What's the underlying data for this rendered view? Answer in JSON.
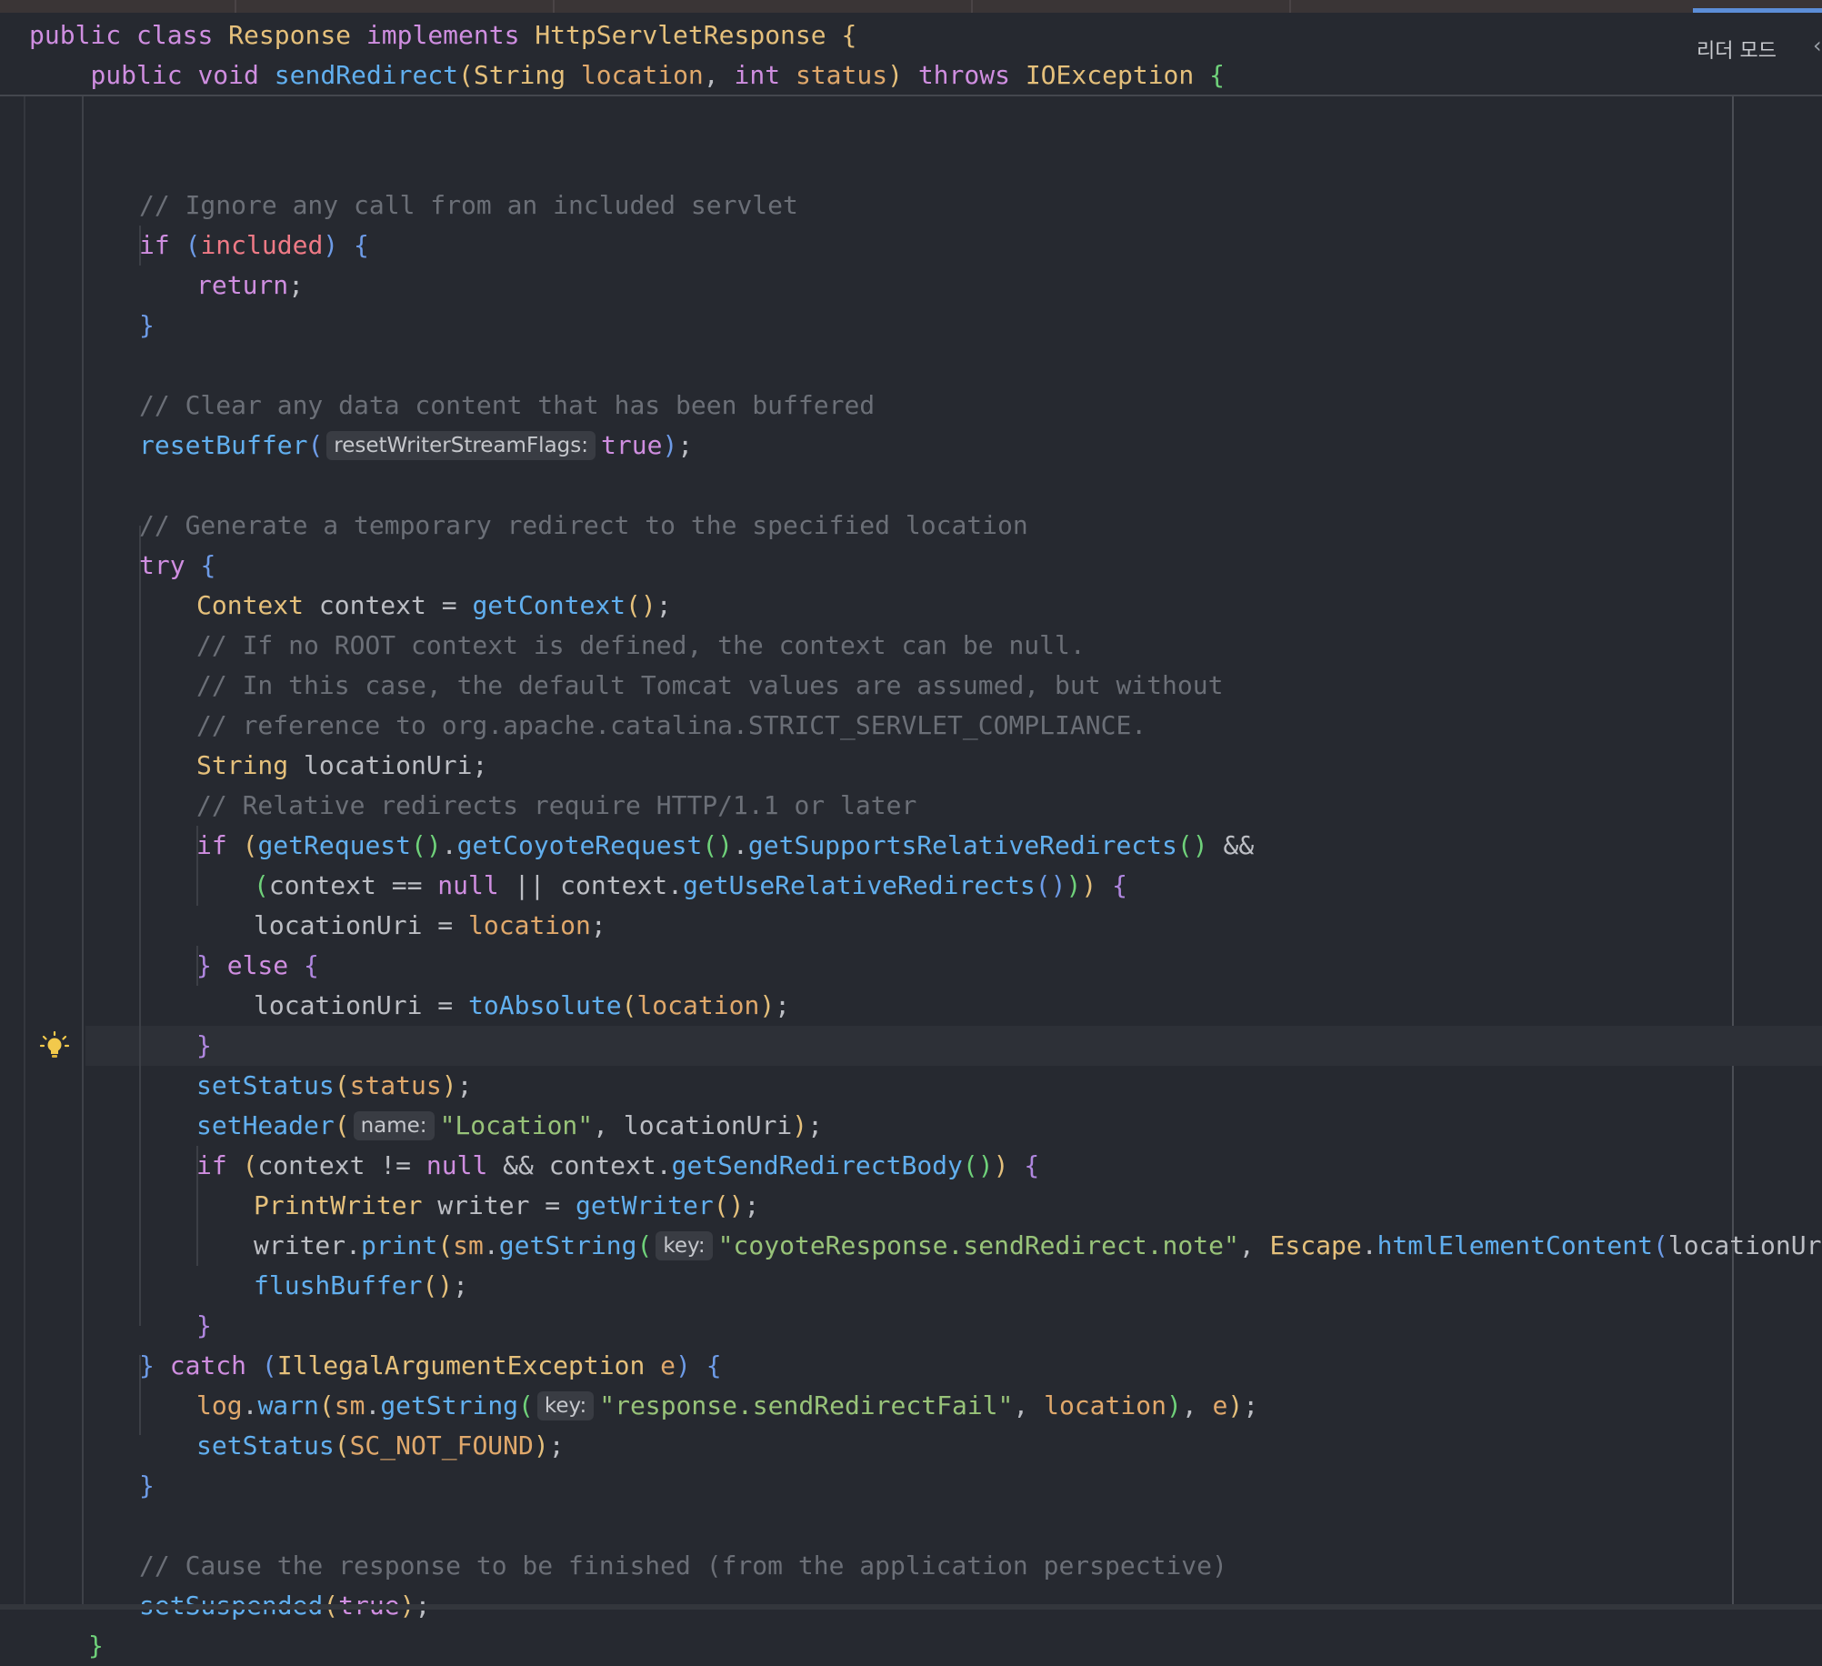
{
  "header": {
    "reader_mode_label": "리더 모드",
    "chevron": "‹",
    "sticky_lines": [
      [
        [
          "kw",
          "public"
        ],
        [
          "pl",
          " "
        ],
        [
          "kw",
          "class"
        ],
        [
          "pl",
          " "
        ],
        [
          "ty",
          "Response"
        ],
        [
          "pl",
          " "
        ],
        [
          "kw",
          "implements"
        ],
        [
          "pl",
          " "
        ],
        [
          "ty",
          "HttpServletResponse"
        ],
        [
          "pl",
          " "
        ],
        [
          "b1",
          "{"
        ]
      ],
      [
        [
          "pl",
          "    "
        ],
        [
          "kw",
          "public"
        ],
        [
          "pl",
          " "
        ],
        [
          "kw",
          "void"
        ],
        [
          "pl",
          " "
        ],
        [
          "fn",
          "sendRedirect"
        ],
        [
          "b1",
          "("
        ],
        [
          "ty",
          "String"
        ],
        [
          "pl",
          " "
        ],
        [
          "pm",
          "location"
        ],
        [
          "pl",
          ", "
        ],
        [
          "kw",
          "int"
        ],
        [
          "pl",
          " "
        ],
        [
          "pm",
          "status"
        ],
        [
          "b1",
          ")"
        ],
        [
          "pl",
          " "
        ],
        [
          "kw",
          "throws"
        ],
        [
          "pl",
          " "
        ],
        [
          "ty",
          "IOException"
        ],
        [
          "pl",
          " "
        ],
        [
          "b2",
          "{"
        ]
      ]
    ]
  },
  "editor": {
    "lightbulb_icon": "lightbulb-icon",
    "lines": [
      {
        "i": 0,
        "t": []
      },
      {
        "i": 2,
        "t": [
          [
            "cm",
            "// Ignore any call from an included servlet"
          ]
        ]
      },
      {
        "i": 2,
        "t": [
          [
            "kw",
            "if"
          ],
          [
            "pl",
            " "
          ],
          [
            "b3",
            "("
          ],
          [
            "pr",
            "included"
          ],
          [
            "b3",
            ")"
          ],
          [
            "pl",
            " "
          ],
          [
            "b3",
            "{"
          ]
        ]
      },
      {
        "i": 3,
        "t": [
          [
            "kw",
            "return"
          ],
          [
            "pl",
            ";"
          ]
        ]
      },
      {
        "i": 2,
        "t": [
          [
            "b3",
            "}"
          ]
        ]
      },
      {
        "i": 0,
        "t": []
      },
      {
        "i": 2,
        "t": [
          [
            "cm",
            "// Clear any data content that has been buffered"
          ]
        ]
      },
      {
        "i": 2,
        "t": [
          [
            "fn",
            "resetBuffer"
          ],
          [
            "b3",
            "("
          ],
          [
            "hint",
            "resetWriterStreamFlags:"
          ],
          [
            "kw",
            "true"
          ],
          [
            "b3",
            ")"
          ],
          [
            "pl",
            ";"
          ]
        ]
      },
      {
        "i": 0,
        "t": []
      },
      {
        "i": 2,
        "t": [
          [
            "cm",
            "// Generate a temporary redirect to the specified location"
          ]
        ]
      },
      {
        "i": 2,
        "t": [
          [
            "kw",
            "try"
          ],
          [
            "pl",
            " "
          ],
          [
            "b3",
            "{"
          ]
        ]
      },
      {
        "i": 3,
        "t": [
          [
            "ty",
            "Context"
          ],
          [
            "pl",
            " context = "
          ],
          [
            "fn",
            "getContext"
          ],
          [
            "b1",
            "()"
          ],
          [
            "pl",
            ";"
          ]
        ]
      },
      {
        "i": 3,
        "t": [
          [
            "cm",
            "// If no ROOT context is defined, the context can be null."
          ]
        ]
      },
      {
        "i": 3,
        "t": [
          [
            "cm",
            "// In this case, the default Tomcat values are assumed, but without"
          ]
        ]
      },
      {
        "i": 3,
        "t": [
          [
            "cm",
            "// reference to org.apache.catalina.STRICT_SERVLET_COMPLIANCE."
          ]
        ]
      },
      {
        "i": 3,
        "t": [
          [
            "ty",
            "String"
          ],
          [
            "pl",
            " locationUri;"
          ]
        ]
      },
      {
        "i": 3,
        "t": [
          [
            "cm",
            "// Relative redirects require HTTP/1.1 or later"
          ]
        ]
      },
      {
        "i": 3,
        "t": [
          [
            "kw",
            "if"
          ],
          [
            "pl",
            " "
          ],
          [
            "b1",
            "("
          ],
          [
            "fn",
            "getRequest"
          ],
          [
            "b2",
            "()"
          ],
          [
            "pl",
            "."
          ],
          [
            "fn",
            "getCoyoteRequest"
          ],
          [
            "b2",
            "()"
          ],
          [
            "pl",
            "."
          ],
          [
            "fn",
            "getSupportsRelativeRedirects"
          ],
          [
            "b2",
            "()"
          ],
          [
            "pl",
            " &&"
          ]
        ]
      },
      {
        "i": 4,
        "t": [
          [
            "b2",
            "("
          ],
          [
            "pl",
            "context == "
          ],
          [
            "kw",
            "null"
          ],
          [
            "pl",
            " || context."
          ],
          [
            "fn",
            "getUseRelativeRedirects"
          ],
          [
            "b3",
            "()"
          ],
          [
            "b2",
            ")"
          ],
          [
            "b1",
            ")"
          ],
          [
            "pl",
            " "
          ],
          [
            "b4",
            "{"
          ]
        ]
      },
      {
        "i": 4,
        "t": [
          [
            "pl",
            "locationUri = "
          ],
          [
            "pm",
            "location"
          ],
          [
            "pl",
            ";"
          ]
        ]
      },
      {
        "i": 3,
        "t": [
          [
            "b4",
            "}"
          ],
          [
            "pl",
            " "
          ],
          [
            "kw",
            "else"
          ],
          [
            "pl",
            " "
          ],
          [
            "b4",
            "{"
          ]
        ]
      },
      {
        "i": 4,
        "t": [
          [
            "pl",
            "locationUri = "
          ],
          [
            "fn",
            "toAbsolute"
          ],
          [
            "b1",
            "("
          ],
          [
            "pm",
            "location"
          ],
          [
            "b1",
            ")"
          ],
          [
            "pl",
            ";"
          ]
        ]
      },
      {
        "i": 3,
        "t": [
          [
            "b4",
            "}"
          ]
        ]
      },
      {
        "i": 3,
        "t": [
          [
            "fn",
            "setStatus"
          ],
          [
            "b1",
            "("
          ],
          [
            "pm",
            "status"
          ],
          [
            "b1",
            ")"
          ],
          [
            "pl",
            ";"
          ]
        ]
      },
      {
        "i": 3,
        "t": [
          [
            "fn",
            "setHeader"
          ],
          [
            "b1",
            "("
          ],
          [
            "hint",
            "name:"
          ],
          [
            "st",
            "\"Location\""
          ],
          [
            "pl",
            ", locationUri"
          ],
          [
            "b1",
            ")"
          ],
          [
            "pl",
            ";"
          ]
        ]
      },
      {
        "i": 3,
        "t": [
          [
            "kw",
            "if"
          ],
          [
            "pl",
            " "
          ],
          [
            "b1",
            "("
          ],
          [
            "pl",
            "context != "
          ],
          [
            "kw",
            "null"
          ],
          [
            "pl",
            " && context."
          ],
          [
            "fn",
            "getSendRedirectBody"
          ],
          [
            "b2",
            "()"
          ],
          [
            "b1",
            ")"
          ],
          [
            "pl",
            " "
          ],
          [
            "b4",
            "{"
          ]
        ]
      },
      {
        "i": 4,
        "t": [
          [
            "ty",
            "PrintWriter"
          ],
          [
            "pl",
            " writer = "
          ],
          [
            "fn",
            "getWriter"
          ],
          [
            "b1",
            "()"
          ],
          [
            "pl",
            ";"
          ]
        ]
      },
      {
        "i": 4,
        "t": [
          [
            "pl",
            "writer."
          ],
          [
            "fn",
            "print"
          ],
          [
            "b1",
            "("
          ],
          [
            "pm",
            "sm"
          ],
          [
            "pl",
            "."
          ],
          [
            "fn",
            "getString"
          ],
          [
            "b2",
            "("
          ],
          [
            "hint",
            "key:"
          ],
          [
            "st",
            "\"coyoteResponse.sendRedirect.note\""
          ],
          [
            "pl",
            ", "
          ],
          [
            "ty",
            "Escape"
          ],
          [
            "pl",
            "."
          ],
          [
            "fn",
            "htmlElementContent"
          ],
          [
            "b3",
            "("
          ],
          [
            "pl",
            "locationUri"
          ],
          [
            "b3",
            ")"
          ],
          [
            "b2",
            ")"
          ],
          [
            "b1",
            ")"
          ],
          [
            "pl",
            ";"
          ]
        ]
      },
      {
        "i": 4,
        "t": [
          [
            "fn",
            "flushBuffer"
          ],
          [
            "b1",
            "()"
          ],
          [
            "pl",
            ";"
          ]
        ]
      },
      {
        "i": 3,
        "t": [
          [
            "b4",
            "}"
          ]
        ]
      },
      {
        "i": 2,
        "t": [
          [
            "b3",
            "}"
          ],
          [
            "pl",
            " "
          ],
          [
            "kw",
            "catch"
          ],
          [
            "pl",
            " "
          ],
          [
            "b3",
            "("
          ],
          [
            "ty",
            "IllegalArgumentException"
          ],
          [
            "pl",
            " "
          ],
          [
            "pm",
            "e"
          ],
          [
            "b3",
            ")"
          ],
          [
            "pl",
            " "
          ],
          [
            "b3",
            "{"
          ]
        ]
      },
      {
        "i": 3,
        "t": [
          [
            "pm",
            "log"
          ],
          [
            "pl",
            "."
          ],
          [
            "fn",
            "warn"
          ],
          [
            "b1",
            "("
          ],
          [
            "pm",
            "sm"
          ],
          [
            "pl",
            "."
          ],
          [
            "fn",
            "getString"
          ],
          [
            "b2",
            "("
          ],
          [
            "hint",
            "key:"
          ],
          [
            "st",
            "\"response.sendRedirectFail\""
          ],
          [
            "pl",
            ", "
          ],
          [
            "pm",
            "location"
          ],
          [
            "b2",
            ")"
          ],
          [
            "pl",
            ", "
          ],
          [
            "pm",
            "e"
          ],
          [
            "b1",
            ")"
          ],
          [
            "pl",
            ";"
          ]
        ]
      },
      {
        "i": 3,
        "t": [
          [
            "fn",
            "setStatus"
          ],
          [
            "b1",
            "("
          ],
          [
            "pm",
            "SC_NOT_FOUND"
          ],
          [
            "b1",
            ")"
          ],
          [
            "pl",
            ";"
          ]
        ]
      },
      {
        "i": 2,
        "t": [
          [
            "b3",
            "}"
          ]
        ]
      },
      {
        "i": 0,
        "t": []
      },
      {
        "i": 2,
        "t": [
          [
            "cm",
            "// Cause the response to be finished (from the application perspective)"
          ]
        ]
      },
      {
        "i": 2,
        "t": [
          [
            "fn",
            "setSuspended"
          ],
          [
            "b1",
            "("
          ],
          [
            "kw",
            "true"
          ],
          [
            "b1",
            ")"
          ],
          [
            "pl",
            ";"
          ]
        ]
      },
      {
        "i": 1,
        "t": [
          [
            "b2",
            "}"
          ]
        ]
      }
    ]
  }
}
